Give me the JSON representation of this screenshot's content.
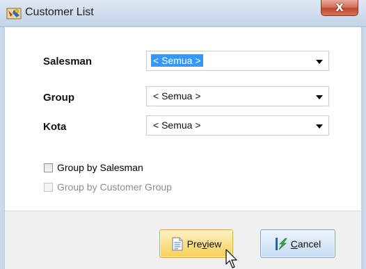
{
  "window": {
    "title": "Customer List",
    "close_label": "X"
  },
  "form": {
    "salesman": {
      "label": "Salesman",
      "value": "< Semua >",
      "focused": true
    },
    "group": {
      "label": "Group",
      "value": "< Semua >"
    },
    "kota": {
      "label": "Kota",
      "value": "< Semua >"
    }
  },
  "options": {
    "group_by_salesman": {
      "label": "Group by Salesman",
      "checked": false,
      "enabled": true
    },
    "group_by_customer_group": {
      "label": "Group by Customer Group",
      "checked": false,
      "enabled": false
    }
  },
  "buttons": {
    "preview": {
      "label_pre": "Pre",
      "label_accel": "v",
      "label_post": "iew",
      "icon": "document-preview-icon"
    },
    "cancel": {
      "label_accel": "C",
      "label_post": "ancel",
      "icon": "green-arrow-icon"
    }
  },
  "colors": {
    "selection": "#3399ff",
    "close_button": "#c1472d",
    "preview_button": "#fbe08c",
    "cancel_button": "#d9e8f7"
  }
}
